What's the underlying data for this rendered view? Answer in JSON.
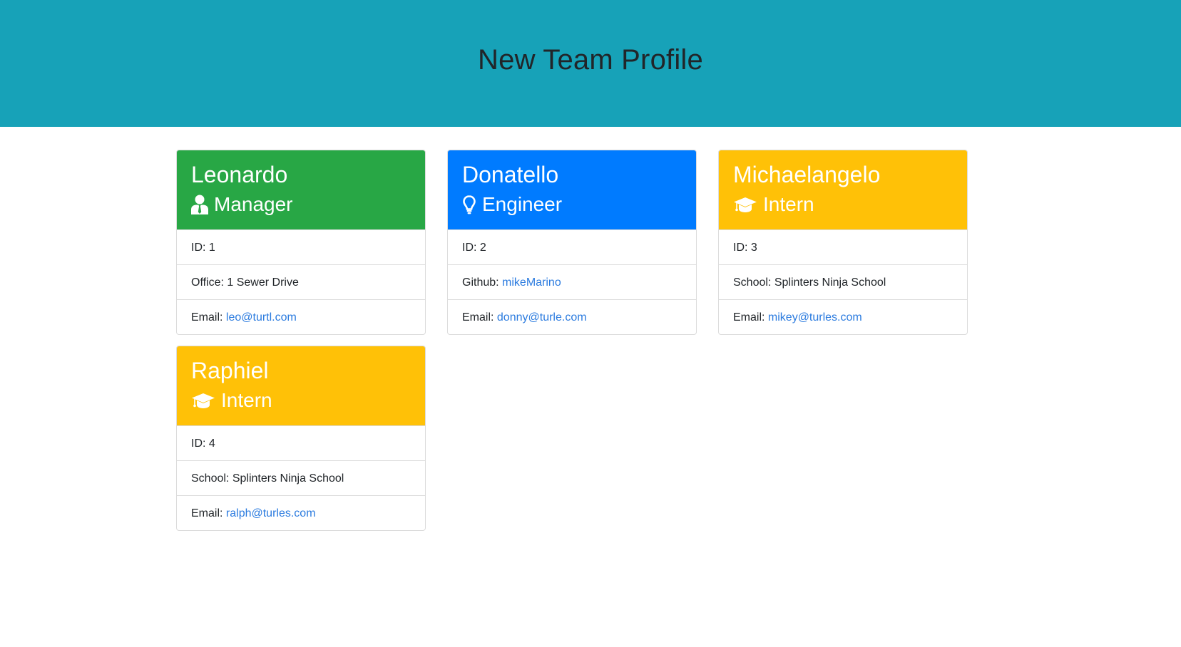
{
  "page": {
    "title": "New Team Profile"
  },
  "colors": {
    "banner": "#17a2b8",
    "manager": "#28a745",
    "engineer": "#007bff",
    "intern": "#ffc107",
    "link": "#2b7bdf"
  },
  "employees": [
    {
      "name": "Leonardo",
      "role": "Manager",
      "icon": "user-tie-icon",
      "id_text": "ID: 1",
      "detail_label": "Office: ",
      "detail_value": "1 Sewer Drive",
      "email_label": "Email: ",
      "email": "leo@turtl.com"
    },
    {
      "name": "Donatello",
      "role": "Engineer",
      "icon": "lightbulb-icon",
      "id_text": "ID: 2",
      "detail_label": "Github: ",
      "detail_value": "mikeMarino",
      "email_label": "Email: ",
      "email": "donny@turle.com"
    },
    {
      "name": "Michaelangelo",
      "role": "Intern",
      "icon": "graduation-cap-icon",
      "id_text": "ID: 3",
      "detail_label": "School: ",
      "detail_value": "Splinters Ninja School",
      "email_label": "Email: ",
      "email": "mikey@turles.com"
    },
    {
      "name": "Raphiel",
      "role": "Intern",
      "icon": "graduation-cap-icon",
      "id_text": "ID: 4",
      "detail_label": "School: ",
      "detail_value": "Splinters Ninja School",
      "email_label": "Email: ",
      "email": "ralph@turles.com"
    }
  ]
}
